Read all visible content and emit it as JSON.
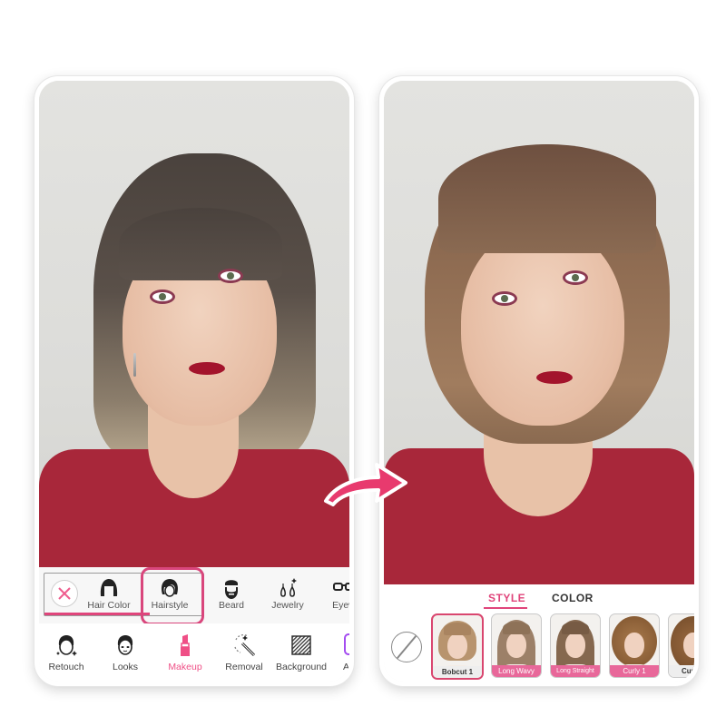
{
  "before": {
    "sub_toolbar": {
      "items": [
        {
          "label": "Hair Color",
          "icon": "hair-color-icon"
        },
        {
          "label": "Hairstyle",
          "icon": "hairstyle-icon",
          "highlighted": true
        },
        {
          "label": "Beard",
          "icon": "beard-icon"
        },
        {
          "label": "Jewelry",
          "icon": "jewelry-icon"
        },
        {
          "label": "Eyew",
          "icon": "eyewear-icon"
        }
      ],
      "cancel_icon": "close-icon"
    },
    "main_toolbar": {
      "items": [
        {
          "label": "Retouch",
          "icon": "retouch-icon"
        },
        {
          "label": "Looks",
          "icon": "looks-icon"
        },
        {
          "label": "Makeup",
          "icon": "lipstick-icon",
          "active": true
        },
        {
          "label": "Removal",
          "icon": "magic-wand-icon"
        },
        {
          "label": "Background",
          "icon": "background-icon"
        },
        {
          "label": "AI",
          "icon": "ai-icon"
        }
      ]
    }
  },
  "after": {
    "tabs": [
      {
        "label": "STYLE",
        "active": true
      },
      {
        "label": "COLOR",
        "active": false
      }
    ],
    "none_icon": "no-style-icon",
    "styles": [
      {
        "label": "Bobcut 1",
        "selected": true
      },
      {
        "label": "Long Wavy",
        "selected": false
      },
      {
        "label": "Long Straight",
        "selected": false
      },
      {
        "label": "Curly 1",
        "selected": false
      },
      {
        "label": "Curl",
        "selected": false
      }
    ]
  },
  "colors": {
    "accent": "#e0457b",
    "arrow": "#e83a6e",
    "dress": "#a8273a"
  },
  "transition_icon": "arrow-right-icon"
}
